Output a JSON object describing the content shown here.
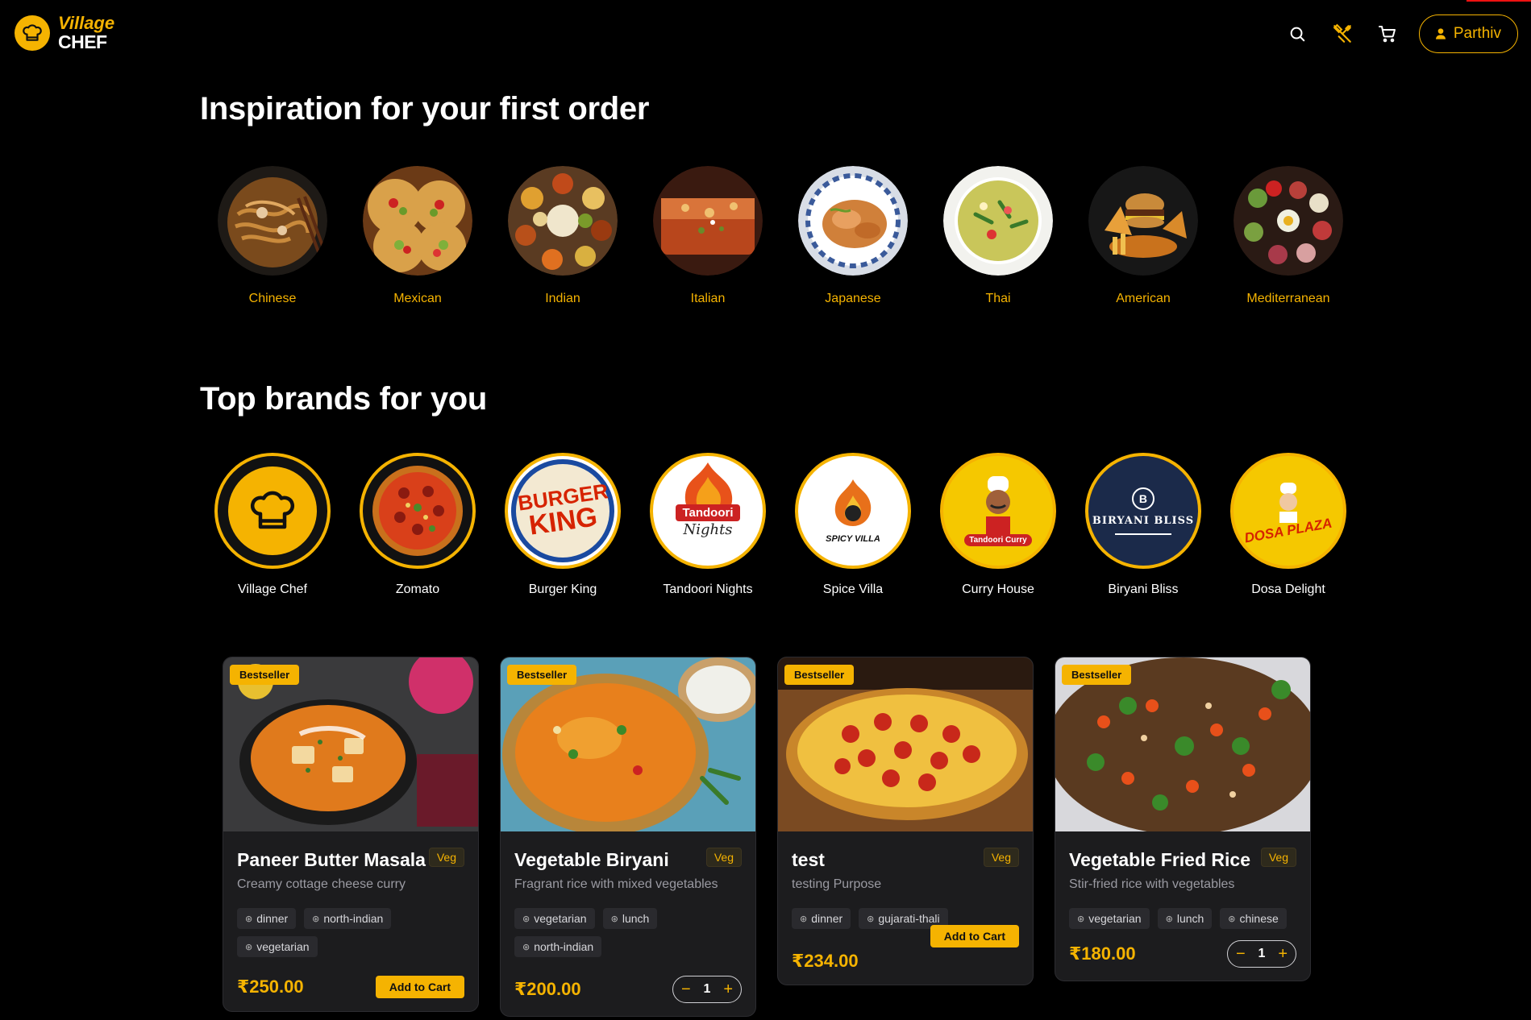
{
  "header": {
    "logo_line1": "Village",
    "logo_line2": "CHEF",
    "user_label": "Parthiv"
  },
  "colors": {
    "accent": "#f5b301",
    "background": "#000000",
    "card": "#1c1c1e"
  },
  "sections": {
    "inspiration_title": "Inspiration for your first order",
    "brands_title": "Top brands for you"
  },
  "cuisines": [
    {
      "name": "Chinese"
    },
    {
      "name": "Mexican"
    },
    {
      "name": "Indian"
    },
    {
      "name": "Italian"
    },
    {
      "name": "Japanese"
    },
    {
      "name": "Thai"
    },
    {
      "name": "American"
    },
    {
      "name": "Mediterranean"
    }
  ],
  "brands": [
    {
      "name": "Village Chef"
    },
    {
      "name": "Zomato"
    },
    {
      "name": "Burger King"
    },
    {
      "name": "Tandoori Nights"
    },
    {
      "name": "Spice Villa"
    },
    {
      "name": "Curry House"
    },
    {
      "name": "Biryani Bliss"
    },
    {
      "name": "Dosa Delight"
    }
  ],
  "brand_logo_text": {
    "burger_king_1": "BURGER",
    "burger_king_2": "KING",
    "tandoori": "Tandoori",
    "tandoori_sub": "Nights",
    "spice_villa": "SPICY VILLA",
    "curry": "Tandoori Curry",
    "biryani": "BIRYANI BLISS",
    "dosa": "DOSA PLAZA"
  },
  "products": [
    {
      "badge": "Bestseller",
      "title": "Paneer Butter Masala",
      "veg": "Veg",
      "desc": "Creamy cottage cheese curry",
      "tags": [
        "dinner",
        "north-indian",
        "vegetarian"
      ],
      "price": "₹250.00",
      "action": "Add to Cart"
    },
    {
      "badge": "Bestseller",
      "title": "Vegetable Biryani",
      "veg": "Veg",
      "desc": "Fragrant rice with mixed vegetables",
      "tags": [
        "vegetarian",
        "lunch",
        "north-indian"
      ],
      "price": "₹200.00",
      "qty": "1"
    },
    {
      "badge": "Bestseller",
      "title": "test",
      "veg": "Veg",
      "desc": "testing Purpose",
      "tags": [
        "dinner",
        "gujarati-thali"
      ],
      "price": "₹234.00",
      "action": "Add to Cart"
    },
    {
      "badge": "Bestseller",
      "title": "Vegetable Fried Rice",
      "veg": "Veg",
      "desc": "Stir-fried rice with vegetables",
      "tags": [
        "vegetarian",
        "lunch",
        "chinese"
      ],
      "price": "₹180.00",
      "qty": "1"
    }
  ],
  "stepper": {
    "minus": "−",
    "plus": "+"
  }
}
